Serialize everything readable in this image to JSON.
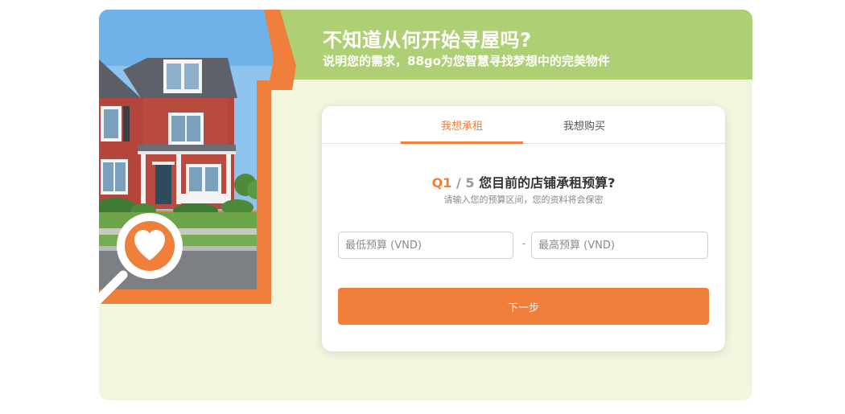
{
  "header": {
    "title": "不知道从何开始寻屋吗?",
    "subtitle": "说明您的需求，88go为您智慧寻找梦想中的完美物件"
  },
  "tabs": [
    {
      "label": "我想承租",
      "active": true
    },
    {
      "label": "我想购买",
      "active": false
    }
  ],
  "question": {
    "number": "Q1",
    "separator": "/",
    "total": "5",
    "text": "您目前的店铺承租预算?",
    "hint": "请输入您的预算区间，您的资料将会保密"
  },
  "budget": {
    "min_placeholder": "最低预算 (VND)",
    "max_placeholder": "最高预算 (VND)",
    "separator": "-"
  },
  "next_button": "下一步",
  "colors": {
    "accent": "#ef7f3a",
    "header_green": "#aecf73",
    "panel_bg": "#f1f6df"
  },
  "icons": {
    "hero": "house-photo",
    "badge": "magnifier-heart-icon"
  }
}
